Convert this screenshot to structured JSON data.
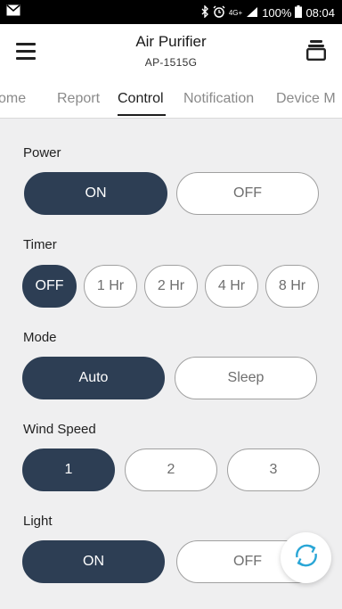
{
  "status_bar": {
    "time": "08:04",
    "battery": "100%",
    "network": "4G+"
  },
  "app_bar": {
    "title": "Air Purifier",
    "subtitle": "AP-1515G"
  },
  "tabs": [
    {
      "label": "ome"
    },
    {
      "label": "Report"
    },
    {
      "label": "Control"
    },
    {
      "label": "Notification"
    },
    {
      "label": "Device M"
    }
  ],
  "active_tab": "Control",
  "sections": {
    "power": {
      "label": "Power",
      "options": [
        "ON",
        "OFF"
      ],
      "selected": "ON"
    },
    "timer": {
      "label": "Timer",
      "options": [
        "OFF",
        "1 Hr",
        "2 Hr",
        "4 Hr",
        "8 Hr"
      ],
      "selected": "OFF"
    },
    "mode": {
      "label": "Mode",
      "options": [
        "Auto",
        "Sleep"
      ],
      "selected": "Auto"
    },
    "wind_speed": {
      "label": "Wind Speed",
      "options": [
        "1",
        "2",
        "3"
      ],
      "selected": "1"
    },
    "light": {
      "label": "Light",
      "options": [
        "ON",
        "OFF"
      ],
      "selected": "ON"
    }
  },
  "colors": {
    "selected": "#2d3e54",
    "background": "#efeff0",
    "refresh_accent": "#2aa6d6"
  },
  "icons": {
    "menu": "hamburger-icon",
    "device": "device-stack-icon",
    "refresh": "refresh-icon"
  }
}
